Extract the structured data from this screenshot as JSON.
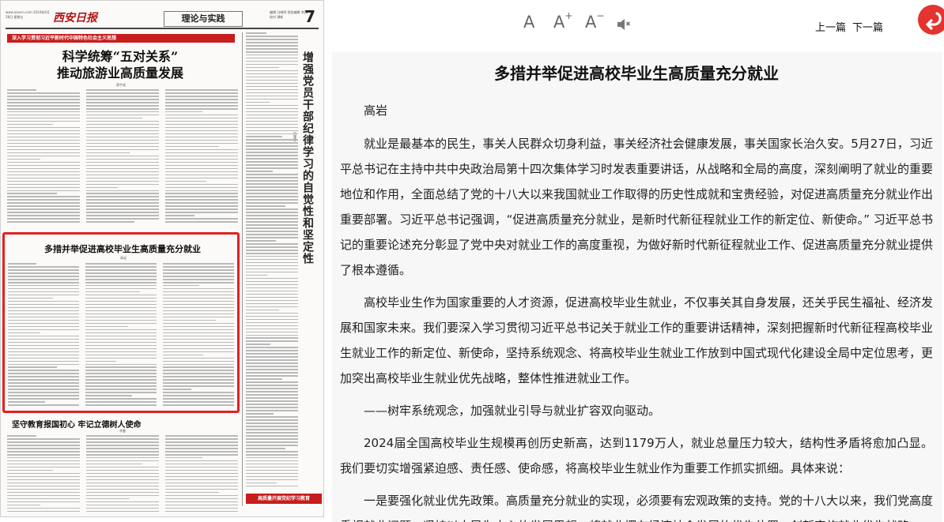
{
  "newspaper": {
    "masthead_logo": "西安日报",
    "masthead_small": "www.xiancn.com 2024年6月28日 星期五",
    "section": "理论与实践",
    "masthead_info": "编辑 冯晓明 视觉编辑 李茜 校对 谭新",
    "page_number": "7",
    "banner": "深入学习贯彻习近平新时代中国特色社会主义思想",
    "headline": "科学统筹“五对关系”\n推动旅游业高质量发展",
    "byline_1": "薛宇成",
    "side_title": "增强党员干部纪律学习的自觉性和坚定性",
    "side_byline": "刘珊珊",
    "highlight_title": "多措并举促进高校毕业生高质量充分就业",
    "highlight_byline": "高岩",
    "sub_title": "坚守教育报国初心 牢记立德树人使命",
    "sub_byline": "李曼",
    "bottom_tag": "高质量开展党纪学习教育"
  },
  "toolbar": {
    "font_normal": "A",
    "font_increase": "A",
    "font_increase_sup": "+",
    "font_decrease": "A",
    "font_decrease_sup": "−",
    "speaker_icon": "speaker-mute-icon",
    "prev_label": "上一篇",
    "next_label": "下一篇",
    "back_icon": "back-arrow-icon",
    "accent_color": "#e3342f"
  },
  "article": {
    "title": "多措并举促进高校毕业生高质量充分就业",
    "author": "高岩",
    "paragraphs": [
      "就业是最基本的民生，事关人民群众切身利益，事关经济社会健康发展，事关国家长治久安。5月27日，习近平总书记在主持中共中央政治局第十四次集体学习时发表重要讲话，从战略和全局的高度，深刻阐明了就业的重要地位和作用，全面总结了党的十八大以来我国就业工作取得的历史性成就和宝贵经验，对促进高质量充分就业作出重要部署。习近平总书记强调，“促进高质量充分就业，是新时代新征程就业工作的新定位、新使命。” 习近平总书记的重要论述充分彰显了党中央对就业工作的高度重视，为做好新时代新征程就业工作、促进高质量充分就业提供了根本遵循。",
      "高校毕业生作为国家重要的人才资源，促进高校毕业生就业，不仅事关其自身发展，还关乎民生福祉、经济发展和国家未来。我们要深入学习贯彻习近平总书记关于就业工作的重要讲话精神，深刻把握新时代新征程高校毕业生就业工作的新定位、新使命，坚持系统观念、将高校毕业生就业工作放到中国式现代化建设全局中定位思考，更加突出高校毕业生就业优先战略，整体性推进就业工作。",
      "——树牢系统观念，加强就业引导与就业扩容双向驱动。",
      "2024届全国高校毕业生规模再创历史新高，达到1179万人，就业总量压力较大，结构性矛盾将愈加凸显。我们要切实增强紧迫感、责任感、使命感，将高校毕业生就业作为重要工作抓实抓细。具体来说：",
      "一是要强化就业优先政策。高质量充分就业的实现，必须要有宏观政策的支持。党的十八大以来，我们党高度重视就业问题，坚持以人民为中心的发展思想，将就业摆在经济社会发展的优先位置，创新实施就业优先战略。"
    ]
  }
}
